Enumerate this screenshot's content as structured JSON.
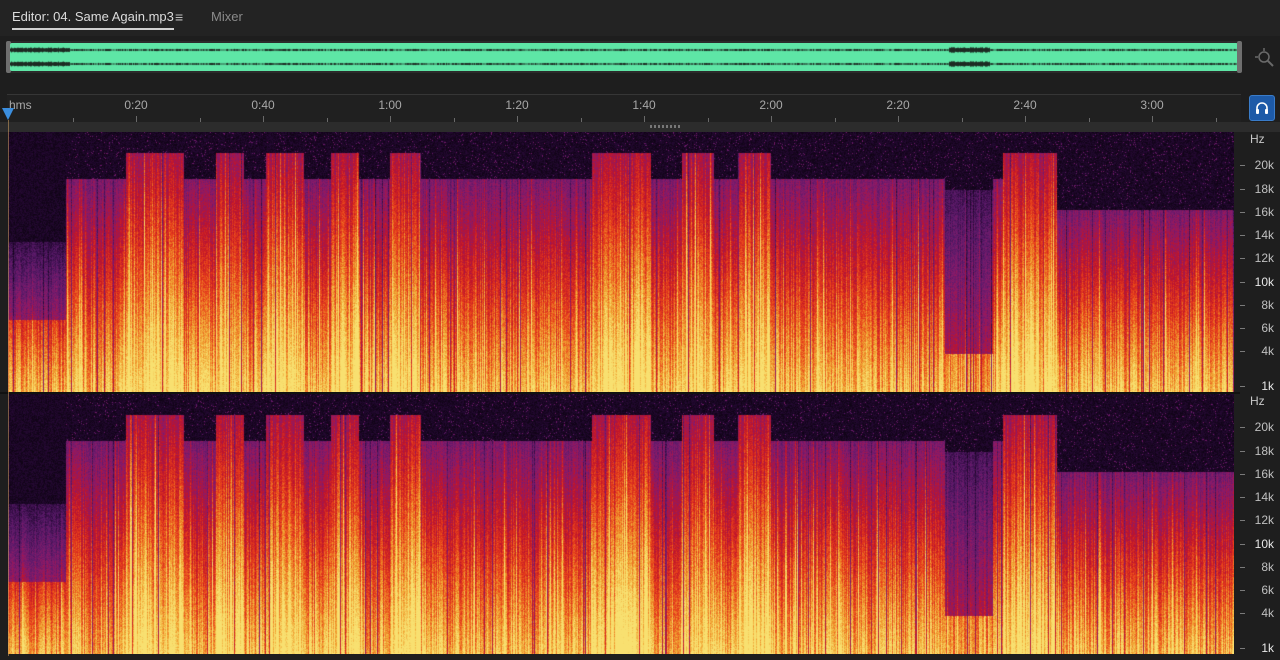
{
  "tabs": {
    "editor_label": "Editor: 04. Same Again.mp3",
    "mixer_label": "Mixer",
    "menu_icon": "≡"
  },
  "overview": {
    "waveform_color": "#5ee6a6"
  },
  "timeline": {
    "unit_label": "hms",
    "labels": [
      "0:20",
      "0:40",
      "1:00",
      "1:20",
      "1:40",
      "2:00",
      "2:20",
      "2:40",
      "3:00"
    ],
    "label_seconds": [
      20,
      40,
      60,
      80,
      100,
      120,
      140,
      160,
      180
    ],
    "minor_tick_seconds": 10,
    "playhead_seconds": 0,
    "playhead_color": "#3b8ede"
  },
  "spectrogram": {
    "freq_unit": "Hz",
    "freq_labels": [
      "20k",
      "18k",
      "16k",
      "14k",
      "12k",
      "10k",
      "8k",
      "6k",
      "4k",
      "1k"
    ],
    "freq_values": [
      20000,
      18000,
      16000,
      14000,
      12000,
      10000,
      8000,
      6000,
      4000,
      1000
    ],
    "palette": [
      "#000000",
      "#2a0a3a",
      "#5a1a6a",
      "#8a1a6a",
      "#c0142a",
      "#e8401a",
      "#f0a030",
      "#f8e070"
    ],
    "channels": [
      {
        "id": "left"
      },
      {
        "id": "right"
      }
    ]
  }
}
